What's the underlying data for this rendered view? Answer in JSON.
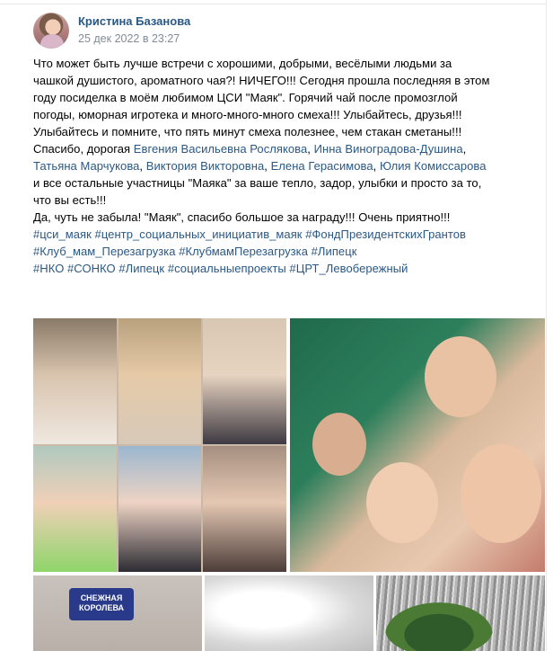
{
  "post": {
    "author": "Кристина Базанова",
    "date": "25 дек 2022 в 23:27"
  },
  "text": {
    "l1": "Что может быть лучше встречи с хорошими, добрыми, весёлыми людьми за",
    "l2": "чашкой душистого, ароматного чая?! НИЧЕГО!!! Сегодня прошла последняя в этом",
    "l3": "году посиделка в моём любимом ЦСИ \"Маяк\". Горячий чай после промозглой",
    "l4": "погоды, юморная игротека и много-много-много смеха!!! Улыбайтесь, друзья!!!",
    "l5": "Улыбайтесь и помните, что пять минут смеха полезнее, чем стакан сметаны!!!",
    "l6_prefix": "Спасибо, дорогая ",
    "mention_roslyakova": "Евгения Васильевна Рослякова",
    "comma1": ", ",
    "mention_vinogradova": "Инна Виноградова-Душина",
    "comma2": ",",
    "mention_marchukova": "Татьяна Марчукова",
    "comma3": ", ",
    "mention_viktoriya": "Виктория Викторовна",
    "comma4": ", ",
    "mention_gerasimova": "Елена Герасимова",
    "comma5": ", ",
    "mention_komissarova": "Юлия Комиссарова",
    "l8": "и все остальные участницы \"Маяка\" за ваше тепло, задор, улыбки и просто за то,",
    "l9": "что вы есть!!!",
    "l10": "Да, чуть не забыла! \"Маяк\", спасибо большое за награду!!! Очень приятно!!!",
    "hashtags_row1": [
      "#цси_маяк",
      "#центр_социальных_инициатив_маяк",
      "#ФондПрезидентскихГрантов"
    ],
    "hashtags_row2": [
      "#Клуб_мам_Перезагрузка",
      "#КлубмамПерезагрузка",
      "#Липецк"
    ],
    "hashtags_row3": [
      "#НКО",
      "#СОНКО",
      "#Липецк",
      "#социальныепроекты",
      "#ЦРТ_Левобережный"
    ]
  },
  "photos": {
    "sticker_text": "СНЕЖНАЯ КОРОЛЕВА"
  },
  "colors": {
    "link": "#2a5885",
    "secondary": "#818c99"
  }
}
